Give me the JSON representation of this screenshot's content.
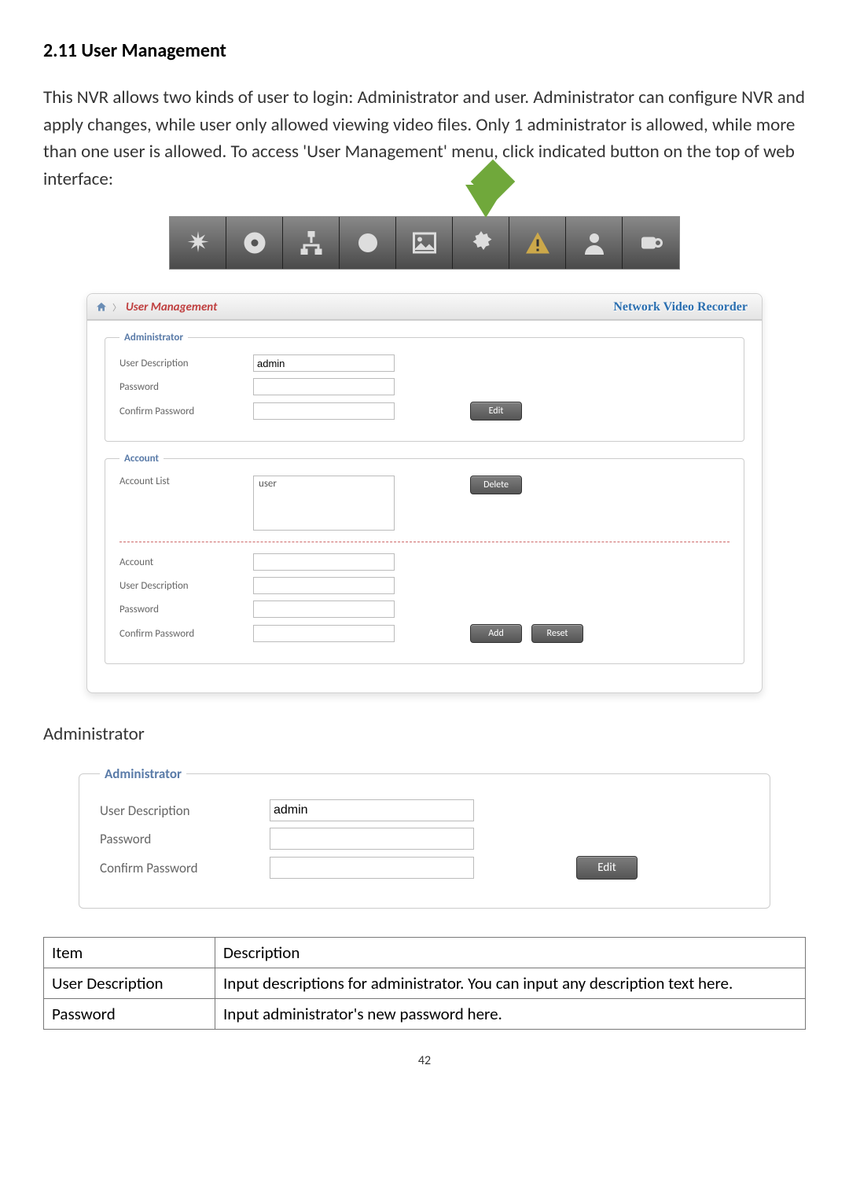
{
  "section_heading": "2.11 User Management",
  "intro_text": "This NVR allows two kinds of user to login: Administrator and user. Administrator can configure NVR and apply changes, while user only allowed viewing video files. Only 1 administrator is allowed, while more than one user is allowed. To access 'User Management' menu, click indicated button on the top of web interface:",
  "panel": {
    "breadcrumb_title": "User Management",
    "product_name": "Network Video Recorder",
    "admin": {
      "legend": "Administrator",
      "labels": {
        "user_desc": "User Description",
        "password": "Password",
        "confirm": "Confirm Password"
      },
      "values": {
        "user_desc": "admin",
        "password": "",
        "confirm": ""
      },
      "edit_btn": "Edit"
    },
    "account": {
      "legend": "Account",
      "list_label": "Account List",
      "list_item": "user",
      "delete_btn": "Delete",
      "labels": {
        "account": "Account",
        "user_desc": "User Description",
        "password": "Password",
        "confirm": "Confirm Password"
      },
      "values": {
        "account": "",
        "user_desc": "",
        "password": "",
        "confirm": ""
      },
      "add_btn": "Add",
      "reset_btn": "Reset"
    }
  },
  "sub_heading": "Administrator",
  "admin_only": {
    "legend": "Administrator",
    "labels": {
      "user_desc": "User Description",
      "password": "Password",
      "confirm": "Confirm Password"
    },
    "values": {
      "user_desc": "admin",
      "password": "",
      "confirm": ""
    },
    "edit_btn": "Edit"
  },
  "table": {
    "headers": {
      "item": "Item",
      "desc": "Description"
    },
    "rows": [
      {
        "item": "User Description",
        "desc": "Input descriptions for administrator. You can input any description text here."
      },
      {
        "item": "Password",
        "desc": "Input administrator's new password here."
      }
    ]
  },
  "page_number": "42"
}
